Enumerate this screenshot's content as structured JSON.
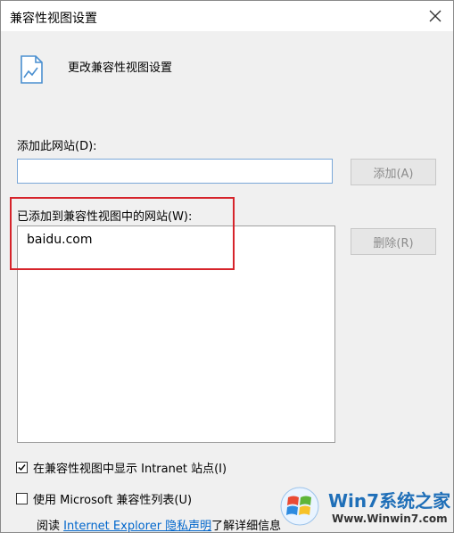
{
  "dialog": {
    "title": "兼容性视图设置",
    "header_text": "更改兼容性视图设置"
  },
  "add_section": {
    "label": "添加此网站(D):",
    "input_value": "",
    "add_button": "添加(A)"
  },
  "list_section": {
    "label": "已添加到兼容性视图中的网站(W):",
    "items": [
      "baidu.com"
    ],
    "remove_button": "删除(R)"
  },
  "options": {
    "intranet_label": "在兼容性视图中显示 Intranet 站点(I)",
    "intranet_checked": true,
    "microsoft_list_label": "使用 Microsoft 兼容性列表(U)",
    "microsoft_list_checked": false
  },
  "info": {
    "prefix": "阅读",
    "link_text": "Internet Explorer 隐私声明",
    "suffix": "了解详细信息"
  },
  "watermark": {
    "title": "Win7系统之家",
    "url": "Www.Winwin7.com"
  },
  "colors": {
    "highlight_border": "#d6242b",
    "link": "#0066cc",
    "input_border": "#7aa7d8"
  }
}
